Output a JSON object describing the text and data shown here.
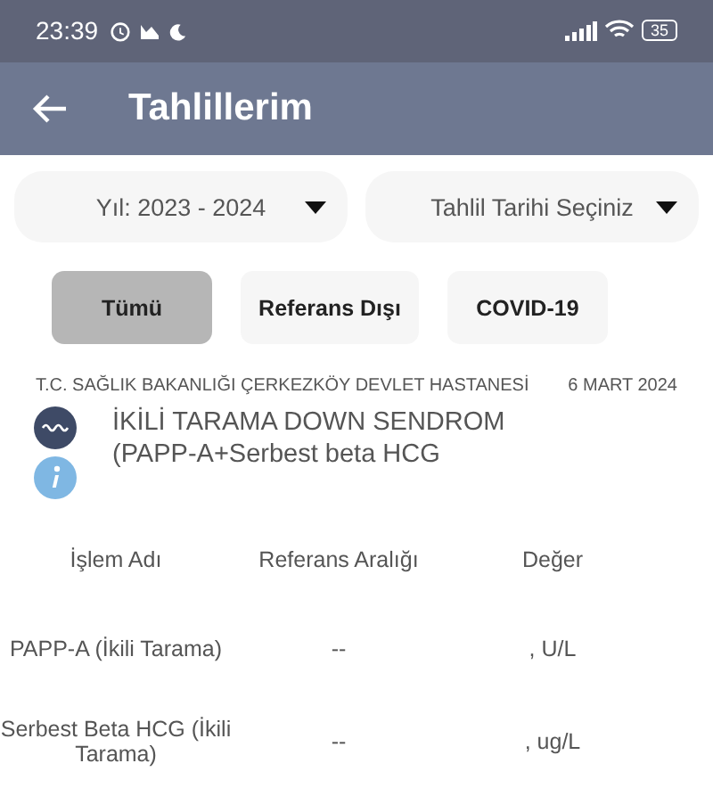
{
  "status_bar": {
    "time": "23:39",
    "battery": "35"
  },
  "app_bar": {
    "title": "Tahlillerim"
  },
  "dropdowns": [
    {
      "label": "Yıl: 2023 - 2024"
    },
    {
      "label": "Tahlil Tarihi Seçiniz"
    }
  ],
  "filters": [
    {
      "label": "Tümü",
      "selected": true
    },
    {
      "label": "Referans Dışı",
      "selected": false
    },
    {
      "label": "COVID-19",
      "selected": false
    }
  ],
  "result": {
    "hospital": "T.C. SAĞLIK BAKANLIĞI ÇERKEZKÖY DEVLET HASTANESİ",
    "date": "6 MART 2024",
    "test_name": "İKİLİ TARAMA DOWN SENDROM (PAPP-A+Serbest beta HCG"
  },
  "table": {
    "columns": [
      "İşlem Adı",
      "Referans Aralığı",
      "Değer"
    ],
    "rows": [
      [
        "PAPP-A (İkili Tarama)",
        "--",
        ", U/L"
      ],
      [
        "Serbest Beta HCG (İkili Tarama)",
        "--",
        ", ug/L"
      ]
    ]
  }
}
